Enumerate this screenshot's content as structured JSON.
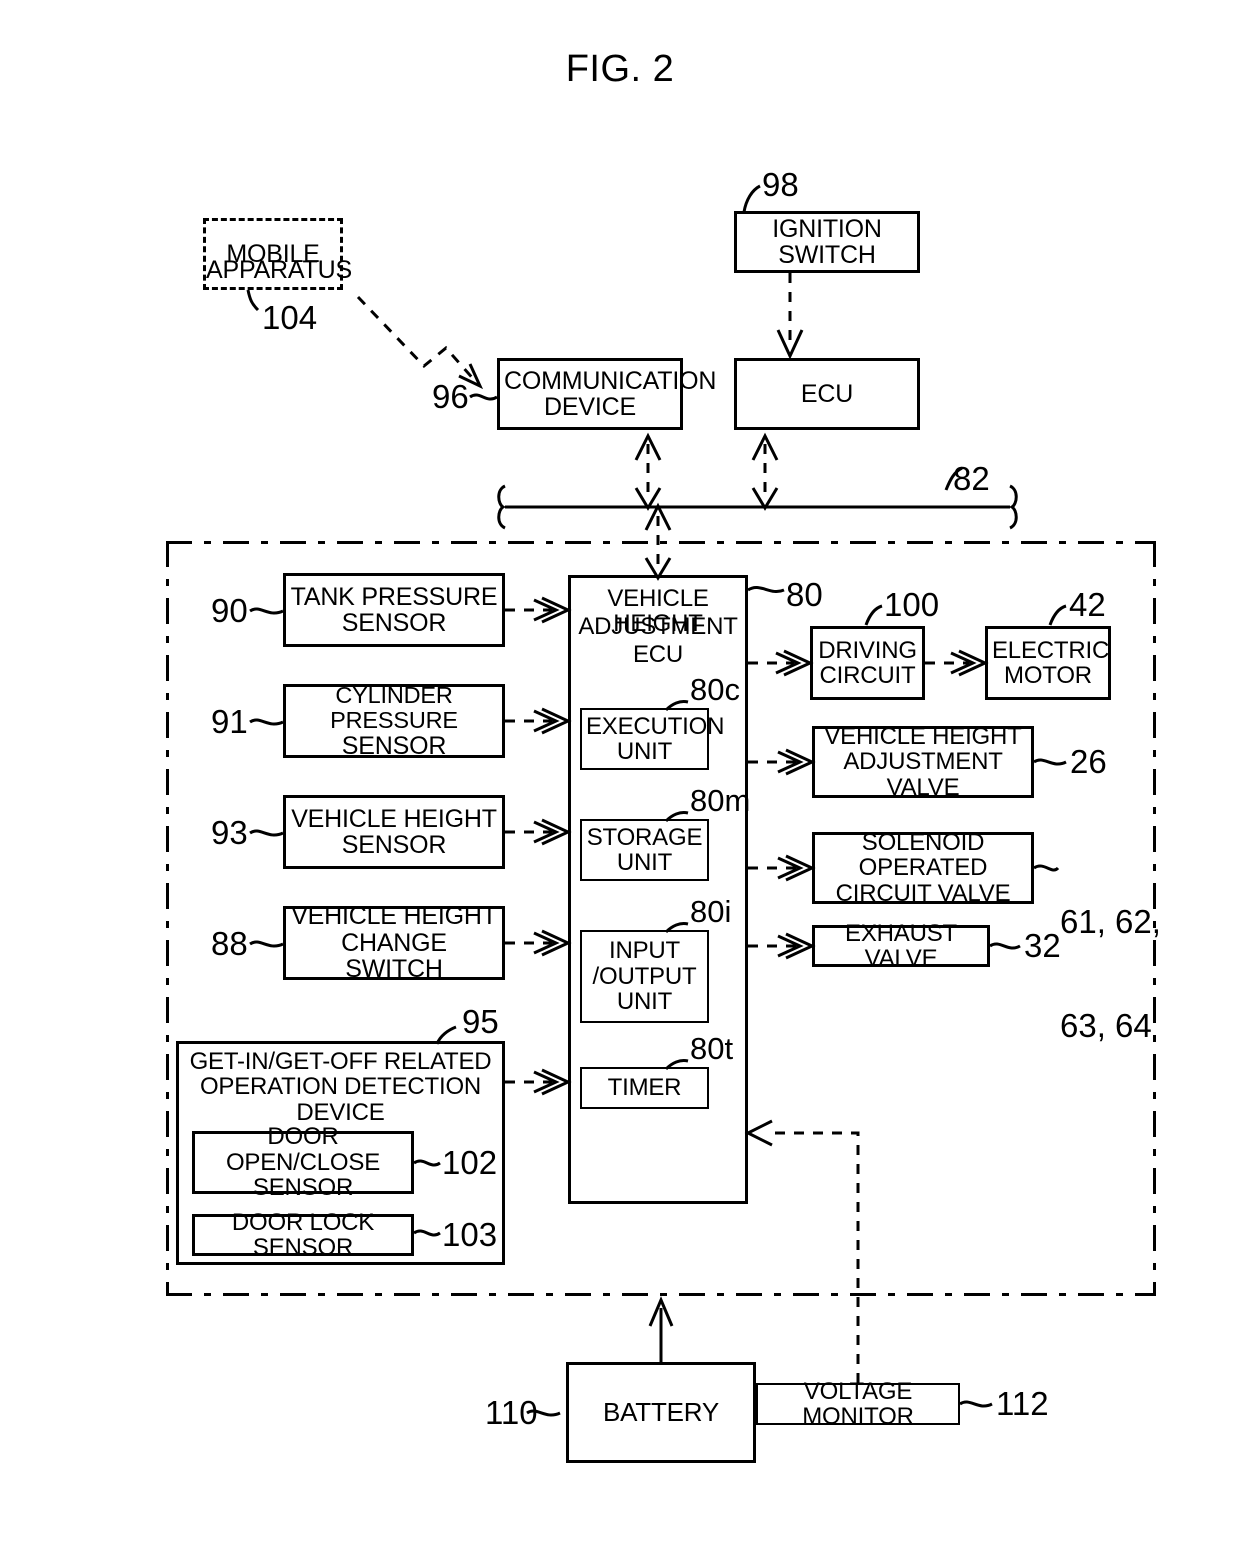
{
  "figure": {
    "title": "FIG. 2"
  },
  "blocks": {
    "mobile_apparatus": {
      "label_line1": "MOBILE",
      "label_line2": "APPARATUS",
      "ref": "104"
    },
    "communication_device": {
      "label_line1": "COMMUNICATION",
      "label_line2": "DEVICE",
      "ref": "96"
    },
    "ignition_switch": {
      "label": "IGNITION SWITCH",
      "ref": "98"
    },
    "ecu": {
      "label": "ECU"
    },
    "bus": {
      "ref": "82"
    },
    "tank_pressure_sensor": {
      "label_line1": "TANK PRESSURE",
      "label_line2": "SENSOR",
      "ref": "90"
    },
    "cylinder_pressure_sensor": {
      "label_line1": "CYLINDER PRESSURE",
      "label_line2": "SENSOR",
      "ref": "91"
    },
    "vehicle_height_sensor": {
      "label_line1": "VEHICLE HEIGHT",
      "label_line2": "SENSOR",
      "ref": "93"
    },
    "vehicle_height_change_switch": {
      "label_line1": "VEHICLE HEIGHT",
      "label_line2": "CHANGE SWITCH",
      "ref": "88"
    },
    "get_in_get_off_device": {
      "label_line1": "GET-IN/GET-OFF RELATED",
      "label_line2": "OPERATION DETECTION DEVICE",
      "ref": "95"
    },
    "door_open_close_sensor": {
      "label_line1": "DOOR OPEN/CLOSE",
      "label_line2": "SENSOR",
      "ref": "102"
    },
    "door_lock_sensor": {
      "label": "DOOR LOCK SENSOR",
      "ref": "103"
    },
    "vehicle_height_adjustment_ecu": {
      "label_line1": "VEHICLE HEIGHT",
      "label_line2": "ADJUSTMENT",
      "label_line3": "ECU",
      "ref": "80"
    },
    "execution_unit": {
      "label_line1": "EXECUTION",
      "label_line2": "UNIT",
      "ref": "80c"
    },
    "storage_unit": {
      "label_line1": "STORAGE",
      "label_line2": "UNIT",
      "ref": "80m"
    },
    "input_output_unit": {
      "label_line1": "INPUT",
      "label_line2": "/OUTPUT",
      "label_line3": "UNIT",
      "ref": "80i"
    },
    "timer": {
      "label": "TIMER",
      "ref": "80t"
    },
    "driving_circuit": {
      "label_line1": "DRIVING",
      "label_line2": "CIRCUIT",
      "ref": "100"
    },
    "electric_motor": {
      "label_line1": "ELECTRIC",
      "label_line2": "MOTOR",
      "ref": "42"
    },
    "vehicle_height_adjustment_valve": {
      "label_line1": "VEHICLE HEIGHT",
      "label_line2": "ADJUSTMENT VALVE",
      "ref": "26"
    },
    "solenoid_operated_circuit_valve": {
      "label_line1": "SOLENOID OPERATED",
      "label_line2": "CIRCUIT VALVE",
      "ref_line1": "61, 62,",
      "ref_line2": "63, 64"
    },
    "exhaust_valve": {
      "label": "EXHAUST VALVE",
      "ref": "32"
    },
    "battery": {
      "label": "BATTERY",
      "ref": "110"
    },
    "voltage_monitor": {
      "label": "VOLTAGE MONITOR",
      "ref": "112"
    }
  }
}
